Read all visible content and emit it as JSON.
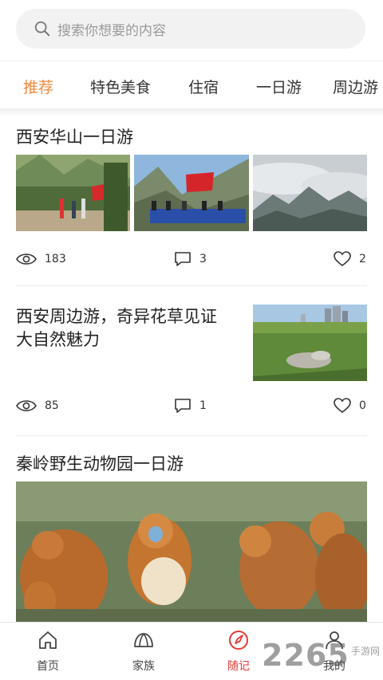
{
  "search": {
    "placeholder": "搜索你想要的内容"
  },
  "tabs": [
    {
      "label": "推荐",
      "active": true
    },
    {
      "label": "特色美食",
      "active": false
    },
    {
      "label": "住宿",
      "active": false
    },
    {
      "label": "一日游",
      "active": false
    },
    {
      "label": "周边游",
      "active": false
    }
  ],
  "articles": [
    {
      "title": "西安华山一日游",
      "views": "183",
      "comments": "3",
      "likes": "2"
    },
    {
      "title_line1": "西安周边游，奇异花草见证",
      "title_line2": "大自然魅力",
      "views": "85",
      "comments": "1",
      "likes": "0"
    },
    {
      "title": "秦岭野生动物园一日游"
    }
  ],
  "nav": [
    {
      "label": "首页",
      "icon": "home-icon",
      "active": false
    },
    {
      "label": "家族",
      "icon": "tent-icon",
      "active": false
    },
    {
      "label": "随记",
      "icon": "compass-icon",
      "active": true
    },
    {
      "label": "我的",
      "icon": "user-icon",
      "active": false
    }
  ],
  "watermark": {
    "brand": "2265",
    "sub": "手游网"
  },
  "colors": {
    "accent": "#f0883a",
    "nav_active": "#e53935"
  }
}
